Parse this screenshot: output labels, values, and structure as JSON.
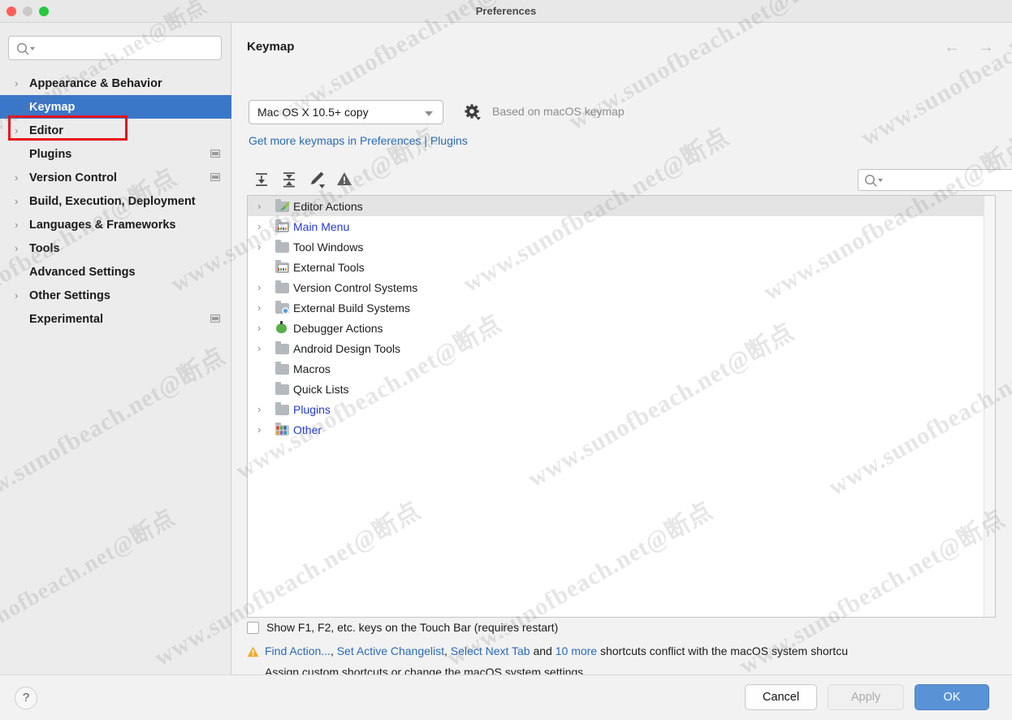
{
  "window": {
    "title": "Preferences"
  },
  "titlebar": {
    "close": "close-button",
    "minimize": "minimize-button",
    "zoom": "zoom-button"
  },
  "sidebar": {
    "search_placeholder": "",
    "items": [
      {
        "label": "Appearance & Behavior",
        "arrow": "›",
        "expandable": true,
        "selected": false,
        "badge": false
      },
      {
        "label": "Keymap",
        "arrow": "›",
        "expandable": false,
        "selected": true,
        "badge": false
      },
      {
        "label": "Editor",
        "arrow": "›",
        "expandable": true,
        "selected": false,
        "badge": false
      },
      {
        "label": "Plugins",
        "arrow": "›",
        "expandable": false,
        "selected": false,
        "badge": true
      },
      {
        "label": "Version Control",
        "arrow": "›",
        "expandable": true,
        "selected": false,
        "badge": true
      },
      {
        "label": "Build, Execution, Deployment",
        "arrow": "›",
        "expandable": true,
        "selected": false,
        "badge": false
      },
      {
        "label": "Languages & Frameworks",
        "arrow": "›",
        "expandable": true,
        "selected": false,
        "badge": false
      },
      {
        "label": "Tools",
        "arrow": "›",
        "expandable": true,
        "selected": false,
        "badge": false
      },
      {
        "label": "Advanced Settings",
        "arrow": "›",
        "expandable": false,
        "selected": false,
        "badge": false
      },
      {
        "label": "Other Settings",
        "arrow": "›",
        "expandable": true,
        "selected": false,
        "badge": false
      },
      {
        "label": "Experimental",
        "arrow": "›",
        "expandable": false,
        "selected": false,
        "badge": true
      }
    ],
    "annotation_color": "#e8131a"
  },
  "main": {
    "page_title": "Keymap",
    "nav": {
      "back": "←",
      "forward": "→"
    },
    "keymap_select": {
      "value": "Mac OS X 10.5+ copy"
    },
    "gear_icon": "gear-icon",
    "based_on": "Based on macOS keymap",
    "get_more_link": "Get more keymaps in Preferences | Plugins",
    "toolbar": {
      "expand_all": "expand-all-icon",
      "collapse_all": "collapse-all-icon",
      "edit": "edit-pencil-icon",
      "conflicts": "warning-triangle-icon",
      "search_placeholder": "",
      "find_shortcut": "find-by-shortcut-icon"
    },
    "tree": [
      {
        "label": "Editor Actions",
        "arrow": "›",
        "expandable": true,
        "icon": "editor-actions-icon",
        "modified": false,
        "selected": true
      },
      {
        "label": "Main Menu",
        "arrow": "›",
        "expandable": true,
        "icon": "main-menu-icon",
        "modified": true,
        "selected": false
      },
      {
        "label": "Tool Windows",
        "arrow": "›",
        "expandable": true,
        "icon": "folder-icon",
        "modified": false,
        "selected": false
      },
      {
        "label": "External Tools",
        "arrow": "›",
        "expandable": false,
        "icon": "external-tools-icon",
        "modified": false,
        "selected": false
      },
      {
        "label": "Version Control Systems",
        "arrow": "›",
        "expandable": true,
        "icon": "folder-icon",
        "modified": false,
        "selected": false
      },
      {
        "label": "External Build Systems",
        "arrow": "›",
        "expandable": true,
        "icon": "build-systems-icon",
        "modified": false,
        "selected": false
      },
      {
        "label": "Debugger Actions",
        "arrow": "›",
        "expandable": true,
        "icon": "debugger-bug-icon",
        "modified": false,
        "selected": false
      },
      {
        "label": "Android Design Tools",
        "arrow": "›",
        "expandable": true,
        "icon": "folder-icon",
        "modified": false,
        "selected": false
      },
      {
        "label": "Macros",
        "arrow": "›",
        "expandable": false,
        "icon": "folder-icon",
        "modified": false,
        "selected": false
      },
      {
        "label": "Quick Lists",
        "arrow": "›",
        "expandable": false,
        "icon": "folder-icon",
        "modified": false,
        "selected": false
      },
      {
        "label": "Plugins",
        "arrow": "›",
        "expandable": true,
        "icon": "folder-icon",
        "modified": true,
        "selected": false
      },
      {
        "label": "Other",
        "arrow": "›",
        "expandable": true,
        "icon": "other-grid-icon",
        "modified": true,
        "selected": false
      }
    ],
    "touchbar_checkbox": {
      "checked": false,
      "label": "Show F1, F2, etc. keys on the Touch Bar (requires restart)"
    },
    "conflict": {
      "icon": "warning-triangle-icon",
      "link1": "Find Action...",
      "sep1": ", ",
      "link2": "Set Active Changelist",
      "sep2": ", ",
      "link3": "Select Next Tab",
      "sep3": " and ",
      "link4": "10 more",
      "tail": " shortcuts conflict with the macOS system shortcu",
      "line2": "Assign custom shortcuts or change the macOS system settings."
    }
  },
  "footer": {
    "help": "?",
    "cancel": "Cancel",
    "apply": "Apply",
    "ok": "OK",
    "apply_enabled": false
  },
  "watermark": {
    "text_a": "www.sunofbeach.net@断点",
    "text_b": "www.sunofbeach.net@断"
  },
  "colors": {
    "accent_blue": "#3b77c9",
    "link_blue": "#2a6ab8",
    "modified_blue": "#2438d8",
    "annotation_red": "#e8131a",
    "ok_button": "#5a92d6"
  }
}
